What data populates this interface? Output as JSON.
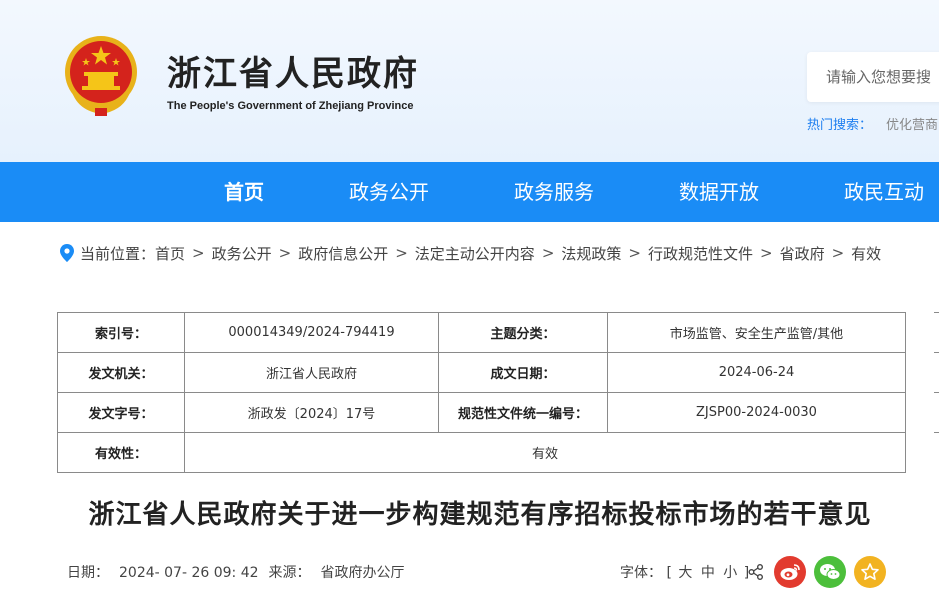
{
  "header": {
    "title": "浙江省人民政府",
    "subtitle": "The People's Government of Zhejiang Province",
    "search_placeholder": "请输入您想要搜",
    "hot_label": "热门搜索：",
    "hot_item": "优化营商"
  },
  "nav": {
    "items": [
      {
        "label": "首页",
        "active": true
      },
      {
        "label": "政务公开",
        "active": false
      },
      {
        "label": "政务服务",
        "active": false
      },
      {
        "label": "数据开放",
        "active": false
      },
      {
        "label": "政民互动",
        "active": false
      }
    ]
  },
  "breadcrumb": {
    "prefix": "当前位置：",
    "items": [
      "首页",
      "政务公开",
      "政府信息公开",
      "法定主动公开内容",
      "法规政策",
      "行政规范性文件",
      "省政府",
      "有效"
    ],
    "separator": ">"
  },
  "info": {
    "index_label": "索引号：",
    "index_value": "000014349/2024-794419",
    "topic_label": "主题分类：",
    "topic_value": "市场监管、安全生产监管/其他",
    "issuer_label": "发文机关：",
    "issuer_value": "浙江省人民政府",
    "date_label": "成文日期：",
    "date_value": "2024-06-24",
    "docno_label": "发文字号：",
    "docno_value": "浙政发〔2024〕17号",
    "code_label": "规范性文件统一编号：",
    "code_value": "ZJSP00-2024-0030",
    "validity_label": "有效性：",
    "validity_value": "有效"
  },
  "article": {
    "title": "浙江省人民政府关于进一步构建规范有序招标投标市场的若干意见",
    "date_label": "日期：",
    "date_value": "2024- 07- 26 09: 42",
    "source_label": "来源：",
    "source_value": "省政府办公厅",
    "font_label": "字体：",
    "font_open": "[",
    "font_large": "大",
    "font_medium": "中",
    "font_small": "小",
    "font_close": "]"
  },
  "colors": {
    "nav_bg": "#1a8cf6",
    "hot_label": "#1e7ff0",
    "weibo": "#e23b2f",
    "wechat": "#4cbf3b",
    "favorite": "#f2b321"
  },
  "icons": [
    "emblem-icon",
    "location-pin-icon",
    "share-icon",
    "weibo-icon",
    "wechat-icon",
    "star-icon"
  ]
}
